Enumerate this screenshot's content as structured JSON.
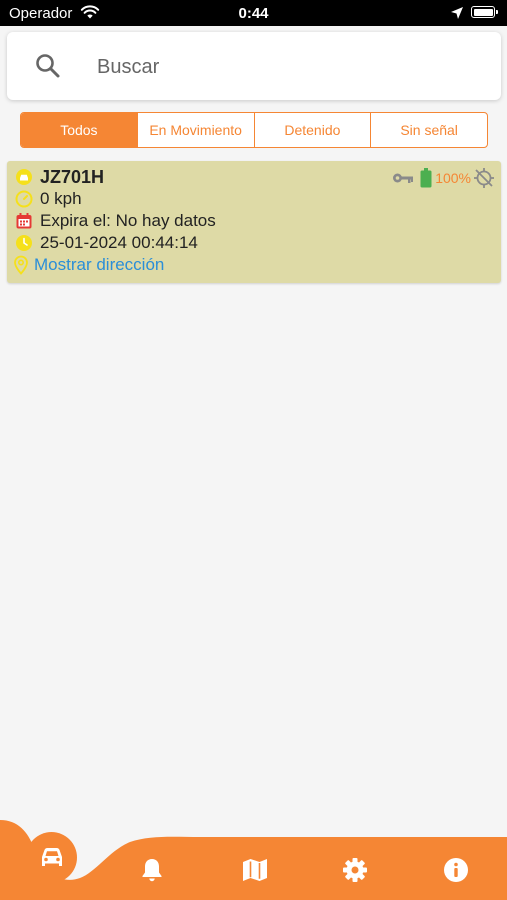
{
  "status_bar": {
    "carrier": "Operador",
    "time": "0:44"
  },
  "search": {
    "placeholder": "Buscar",
    "value": ""
  },
  "filters": {
    "tabs": [
      {
        "label": "Todos",
        "active": true
      },
      {
        "label": "En Movimiento",
        "active": false
      },
      {
        "label": "Detenido",
        "active": false
      },
      {
        "label": "Sin señal",
        "active": false
      }
    ]
  },
  "vehicles": [
    {
      "plate": "JZ701H",
      "speed": "0 kph",
      "expiry": "Expira el: No hay datos",
      "datetime": "25-01-2024 00:44:14",
      "address_link": "Mostrar dirección",
      "battery": "100%",
      "icons": [
        "car-status-icon",
        "speed-icon",
        "calendar-icon",
        "clock-icon",
        "location-pin-icon",
        "key-icon",
        "battery-icon",
        "gps-off-icon"
      ]
    }
  ],
  "nav": {
    "items": [
      "car-icon",
      "bell-icon",
      "map-icon",
      "gear-icon",
      "info-icon"
    ],
    "active": "car-icon"
  },
  "colors": {
    "accent": "#f58634",
    "card_background": "#dedaa6",
    "link": "#2b8ed8",
    "battery_green": "#4caf50",
    "calendar_red": "#e53935",
    "icon_yellow": "#f5e01b"
  }
}
